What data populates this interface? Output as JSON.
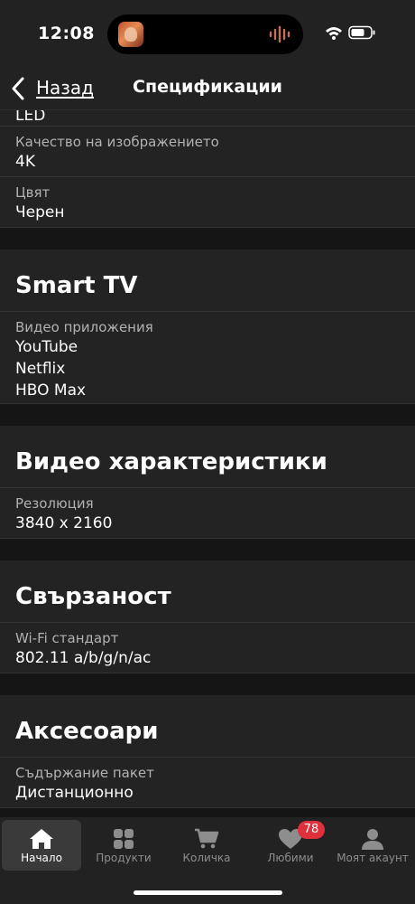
{
  "status_bar": {
    "time": "12:08"
  },
  "nav": {
    "back_label": "Назад",
    "title": "Спецификации"
  },
  "top_rows": [
    {
      "label": "",
      "value": "LED"
    },
    {
      "label": "Качество на изображението",
      "value": "4K"
    },
    {
      "label": "Цвят",
      "value": "Черен"
    }
  ],
  "sections": [
    {
      "title": "Smart TV",
      "rows": [
        {
          "label": "Видео приложения",
          "values": [
            "YouTube",
            "Netflix",
            "HBO Max"
          ]
        }
      ]
    },
    {
      "title": "Видео характеристики",
      "rows": [
        {
          "label": "Резолюция",
          "values": [
            "3840 x 2160"
          ]
        }
      ]
    },
    {
      "title": "Свързаност",
      "rows": [
        {
          "label": "Wi-Fi стандарт",
          "values": [
            "802.11 a/b/g/n/ac"
          ]
        }
      ]
    },
    {
      "title": "Аксесоари",
      "rows": [
        {
          "label": "Съдържание пакет",
          "values": [
            "Дистанционно"
          ]
        }
      ]
    }
  ],
  "tab_bar": {
    "tabs": [
      {
        "label": "Начало",
        "icon": "home-icon",
        "active": true
      },
      {
        "label": "Продукти",
        "icon": "grid-icon",
        "active": false
      },
      {
        "label": "Количка",
        "icon": "cart-icon",
        "active": false
      },
      {
        "label": "Любими",
        "icon": "heart-icon",
        "active": false
      },
      {
        "label": "Моят акаунт",
        "icon": "person-icon",
        "active": false
      }
    ],
    "favorites_badge": "78"
  },
  "colors": {
    "background": "#151515",
    "surface": "#232323",
    "badge": "#e0303c"
  }
}
